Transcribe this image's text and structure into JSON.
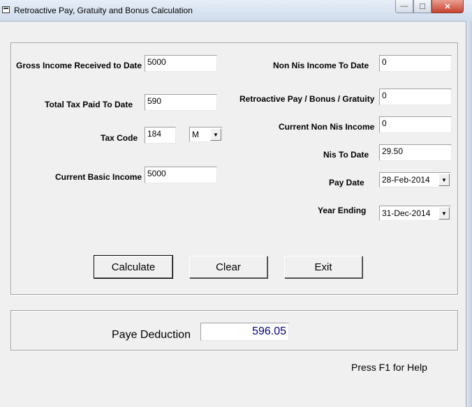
{
  "window": {
    "title": "Retroactive Pay, Gratuity and Bonus Calculation",
    "minimize_glyph": "—",
    "maximize_glyph": "☐",
    "close_glyph": "✕"
  },
  "left": {
    "gross_income_label": "Gross Income Received to Date",
    "gross_income_value": "5000",
    "total_tax_label": "Total Tax Paid To Date",
    "total_tax_value": "590",
    "tax_code_label": "Tax Code",
    "tax_code_value": "184",
    "tax_code_period": "M",
    "basic_income_label": "Current Basic Income",
    "basic_income_value": "5000"
  },
  "right": {
    "non_nis_ytd_label": "Non Nis Income To Date",
    "non_nis_ytd_value": "0",
    "retro_label": "Retroactive Pay / Bonus / Gratuity",
    "retro_value": "0",
    "current_non_nis_label": "Current Non Nis Income",
    "current_non_nis_value": "0",
    "nis_to_date_label": "Nis To Date",
    "nis_to_date_value": "29.50",
    "pay_date_label": "Pay Date",
    "pay_date_value": "28-Feb-2014",
    "year_ending_label": "Year Ending",
    "year_ending_value": "31-Dec-2014"
  },
  "buttons": {
    "calculate": "Calculate",
    "clear": "Clear",
    "exit": "Exit"
  },
  "result": {
    "paye_label": "Paye Deduction",
    "paye_value": "596.05"
  },
  "footer": {
    "help_text": "Press F1 for Help"
  },
  "icons": {
    "dropdown": "chevron-down-icon",
    "app": "app-window-icon"
  },
  "colors": {
    "result_value": "#000080",
    "background": "#f0f0f0"
  }
}
